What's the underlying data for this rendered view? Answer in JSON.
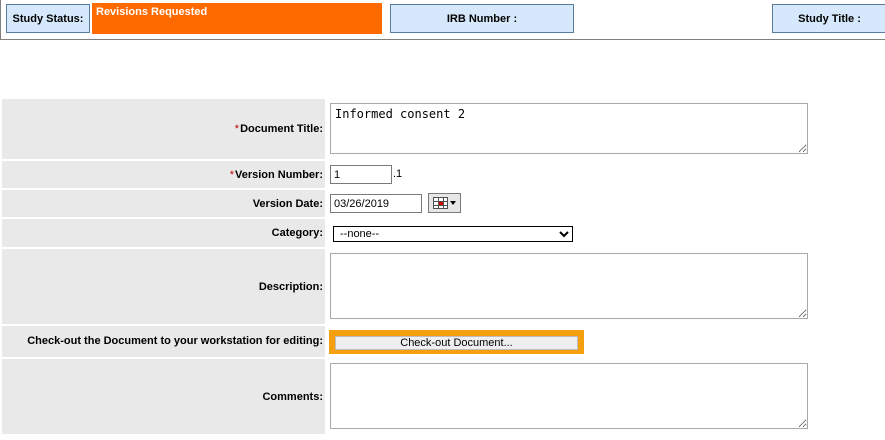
{
  "header": {
    "study_status_label": "Study Status:",
    "study_status_value": "Revisions Requested",
    "irb_number_label": "IRB Number :",
    "study_title_label": "Study Title :"
  },
  "form": {
    "required_marker": "*",
    "document_title": {
      "label": "Document Title:",
      "value": "Informed consent 2"
    },
    "version_number": {
      "label": "Version Number:",
      "value": "1",
      "suffix": ".1"
    },
    "version_date": {
      "label": "Version Date:",
      "value": "03/26/2019"
    },
    "category": {
      "label": "Category:",
      "selected": "--none--"
    },
    "description": {
      "label": "Description:",
      "value": ""
    },
    "checkout": {
      "label": "Check-out the Document to your workstation for editing:",
      "button_label": "Check-out Document..."
    },
    "comments": {
      "label": "Comments:",
      "value": ""
    }
  },
  "colors": {
    "status_bg": "#ff6a00",
    "header_cell_bg": "#d6e8fb",
    "label_bg": "#e9e9e9",
    "highlight": "#f5a00f"
  },
  "icons": {
    "calendar": "calendar-icon",
    "dropdown": "chevron-down-icon"
  }
}
